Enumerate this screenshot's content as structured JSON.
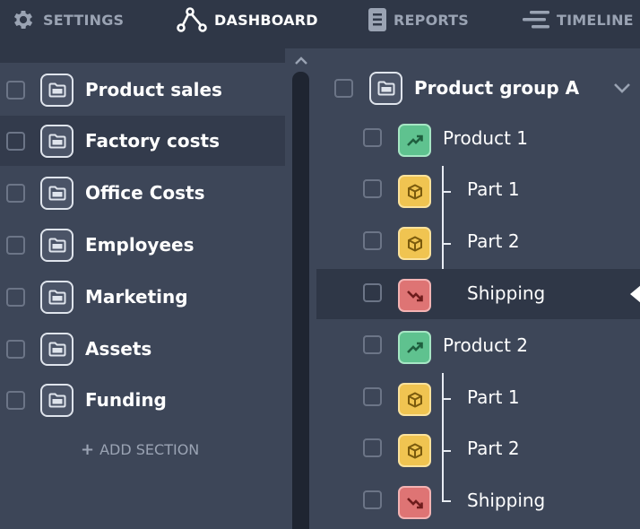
{
  "nav": {
    "items": [
      {
        "label": "SETTINGS",
        "icon": "gear-icon",
        "active": false
      },
      {
        "label": "DASHBOARD",
        "icon": "nodes-icon",
        "active": true
      },
      {
        "label": "REPORTS",
        "icon": "document-icon",
        "active": false
      },
      {
        "label": "TIMELINE",
        "icon": "timeline-icon",
        "active": false
      }
    ]
  },
  "sidebar": {
    "sections": [
      {
        "label": "Product sales",
        "icon": "folder-icon"
      },
      {
        "label": "Factory costs",
        "icon": "folder-icon",
        "selected": true
      },
      {
        "label": "Office Costs",
        "icon": "folder-icon"
      },
      {
        "label": "Employees",
        "icon": "folder-icon"
      },
      {
        "label": "Marketing",
        "icon": "folder-icon"
      },
      {
        "label": "Assets",
        "icon": "folder-icon"
      },
      {
        "label": "Funding",
        "icon": "folder-icon"
      }
    ],
    "add_section_label": "ADD SECTION"
  },
  "main": {
    "group": {
      "label": "Product group A",
      "icon": "folder-icon",
      "expanded": true
    },
    "items": [
      {
        "label": "Product 1",
        "kind": "product",
        "icon": "trend-up-icon",
        "color": "#5fc28f"
      },
      {
        "label": "Part 1",
        "kind": "part",
        "icon": "box-icon",
        "color": "#f0c451"
      },
      {
        "label": "Part 2",
        "kind": "part",
        "icon": "box-icon",
        "color": "#f0c451"
      },
      {
        "label": "Shipping",
        "kind": "part",
        "icon": "trend-down-icon",
        "color": "#de7474",
        "selected": true
      },
      {
        "label": "Product 2",
        "kind": "product",
        "icon": "trend-up-icon",
        "color": "#5fc28f"
      },
      {
        "label": "Part 1",
        "kind": "part",
        "icon": "box-icon",
        "color": "#f0c451"
      },
      {
        "label": "Part 2",
        "kind": "part",
        "icon": "box-icon",
        "color": "#f0c451"
      },
      {
        "label": "Shipping",
        "kind": "part",
        "icon": "trend-down-icon",
        "color": "#de7474"
      }
    ]
  },
  "colors": {
    "nav_bg": "#2f3747",
    "panel_bg": "#3d4658",
    "selected_row": "#333b4c",
    "green": "#5fc28f",
    "yellow": "#f0c451",
    "red": "#de7474"
  }
}
